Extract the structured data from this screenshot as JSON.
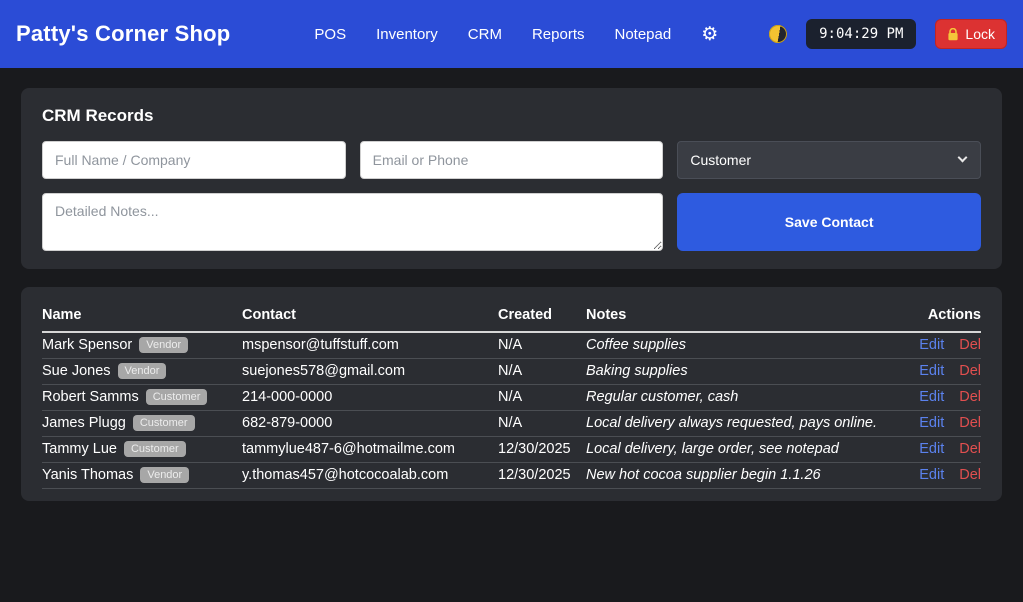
{
  "navbar": {
    "brand": "Patty's Corner Shop",
    "links": [
      {
        "label": "POS"
      },
      {
        "label": "Inventory"
      },
      {
        "label": "CRM"
      },
      {
        "label": "Reports"
      },
      {
        "label": "Notepad"
      }
    ],
    "clock": "9:04:29 PM",
    "lock_label": "Lock"
  },
  "icons": {
    "gear": "⚙",
    "coin": "half-yellow-coin",
    "lock": "padlock",
    "select_chevron": "chevron-down"
  },
  "crm": {
    "title": "CRM Records",
    "name_placeholder": "Full Name / Company",
    "contact_placeholder": "Email or Phone",
    "type_selected": "Customer",
    "notes_placeholder": "Detailed Notes...",
    "save_label": "Save Contact"
  },
  "records": {
    "headers": [
      "Name",
      "Contact",
      "Created",
      "Notes",
      "Actions"
    ],
    "edit_label": "Edit",
    "delete_label": "Del",
    "rows": [
      {
        "name": "Mark Spensor",
        "type": "Vendor",
        "contact": "mspensor@tuffstuff.com",
        "created": "N/A",
        "notes": "Coffee supplies"
      },
      {
        "name": "Sue Jones",
        "type": "Vendor",
        "contact": "suejones578@gmail.com",
        "created": "N/A",
        "notes": "Baking supplies"
      },
      {
        "name": "Robert Samms",
        "type": "Customer",
        "contact": "214-000-0000",
        "created": "N/A",
        "notes": "Regular customer, cash"
      },
      {
        "name": "James Plugg",
        "type": "Customer",
        "contact": "682-879-0000",
        "created": "N/A",
        "notes": "Local delivery always requested, pays online."
      },
      {
        "name": "Tammy Lue",
        "type": "Customer",
        "contact": "tammylue487-6@hotmailme.com",
        "created": "12/30/2025",
        "notes": "Local delivery, large order, see notepad"
      },
      {
        "name": "Yanis Thomas",
        "type": "Vendor",
        "contact": "y.thomas457@hotcocoalab.com",
        "created": "12/30/2025",
        "notes": "New hot cocoa supplier begin 1.1.26"
      }
    ]
  },
  "colors": {
    "navbar_bg": "#2b4cd6",
    "page_bg": "#191a1d",
    "card_bg": "#2b2d32",
    "accent_blue": "#2e5be0",
    "danger_red": "#dc3232",
    "edit_link": "#5b82ee",
    "delete_link": "#e14f4f",
    "badge_bg": "#a7a7a7",
    "clock_bg": "#1b212e"
  }
}
